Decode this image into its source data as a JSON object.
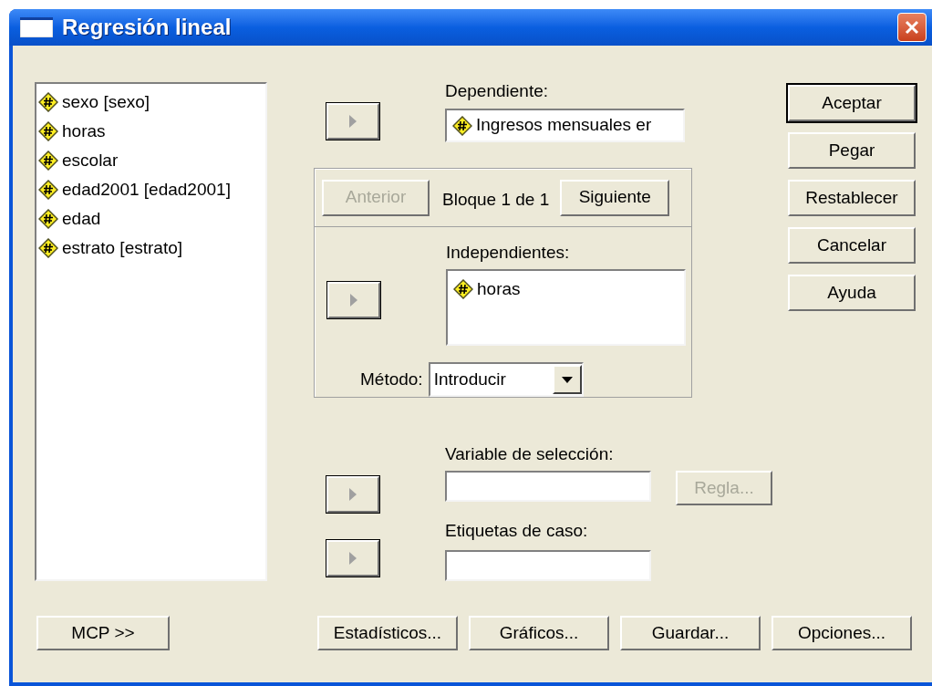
{
  "window": {
    "title": "Regresión lineal"
  },
  "variables": [
    "sexo [sexo]",
    "horas",
    "escolar",
    "edad2001 [edad2001]",
    "edad",
    "estrato [estrato]"
  ],
  "dependent": {
    "label": "Dependiente:",
    "value": "Ingresos mensuales er"
  },
  "block": {
    "previous": {
      "label": "Anterior",
      "disabled": true
    },
    "text": "Bloque 1 de 1",
    "next": {
      "label": "Siguiente",
      "disabled": false
    }
  },
  "independents": {
    "label": "Independientes:",
    "items": [
      "horas"
    ]
  },
  "method": {
    "label": "Método:",
    "value": "Introducir"
  },
  "selection_variable": {
    "label": "Variable de selección:"
  },
  "rule_button": {
    "label": "Regla...",
    "disabled": true
  },
  "case_labels": {
    "label": "Etiquetas de caso:"
  },
  "side_buttons": [
    {
      "label": "Aceptar",
      "default": true
    },
    {
      "label": "Pegar",
      "default": false
    },
    {
      "label": "Restablecer",
      "default": false
    },
    {
      "label": "Cancelar",
      "default": false
    },
    {
      "label": "Ayuda",
      "default": false
    }
  ],
  "mcp_button": "MCP >>",
  "dialog_buttons": [
    "Estadísticos...",
    "Gráficos...",
    "Guardar...",
    "Opciones..."
  ]
}
